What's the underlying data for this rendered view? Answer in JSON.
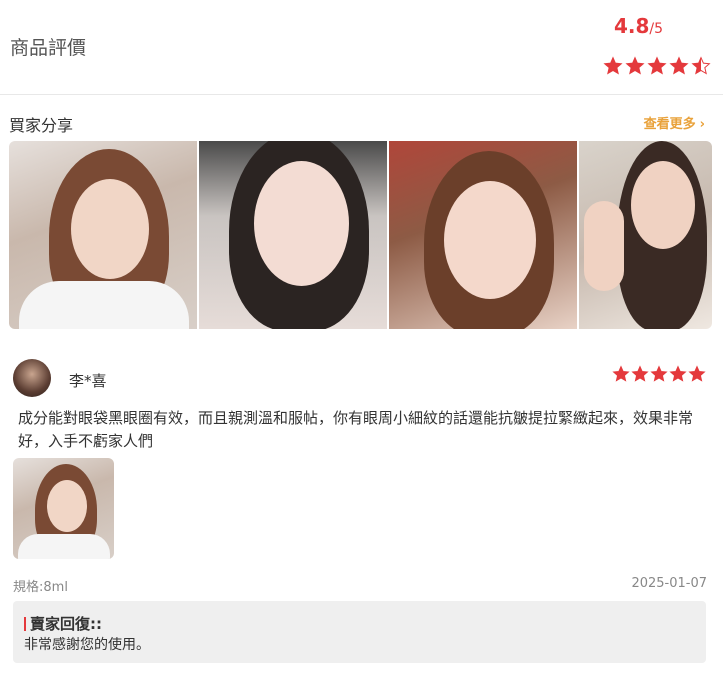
{
  "header": {
    "title": "商品評價",
    "score": "4.8",
    "score_max": "/5",
    "rating": 4.5
  },
  "share": {
    "title": "買家分享",
    "more_label": "查看更多"
  },
  "gallery": {
    "photos": [
      "buyer-photo",
      "buyer-photo",
      "buyer-photo",
      "buyer-photo"
    ]
  },
  "review": {
    "username": "李*喜",
    "rating": 5,
    "text": "成分能對眼袋黑眼圈有效，而且親測溫和服帖，你有眼周小細紋的話還能抗皺提拉緊緻起來，效果非常好，入手不虧家人們",
    "spec": "規格:8ml",
    "date": "2025-01-07",
    "reply_title": "賣家回復::",
    "reply_text": "非常感謝您的使用。"
  },
  "colors": {
    "accent": "#e4393c",
    "more_link": "#e9a23b",
    "reply_bg": "#efefef"
  }
}
